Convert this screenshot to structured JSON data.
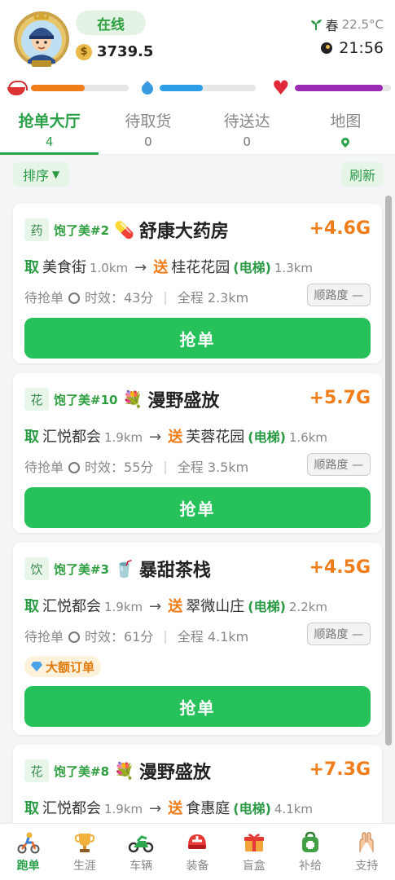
{
  "header": {
    "status": "在线",
    "coins": "3739.5",
    "season": "春",
    "temperature": "22.5°C",
    "time": "21:56",
    "stats": {
      "food": 0.55,
      "water": 0.45,
      "heart": 0.92
    },
    "colors": {
      "food": "#f07d1a",
      "water": "#2d9ee8",
      "heart": "#9b2bb3"
    }
  },
  "tabs": [
    {
      "label": "抢单大厅",
      "count": "4"
    },
    {
      "label": "待取货",
      "count": "0"
    },
    {
      "label": "待送达",
      "count": "0"
    },
    {
      "label": "地图",
      "count": ""
    }
  ],
  "toolbar": {
    "sort_label": "排序",
    "sort_arrow": "▼",
    "refresh_label": "刷新"
  },
  "orders": [
    {
      "category": "药",
      "shop_tag": "饱了美#2",
      "shop_icon": "💊",
      "shop_name": "舒康大药房",
      "reward": "+4.6G",
      "pick_label": "取",
      "pick_place": "美食街",
      "pick_dist": "1.0km",
      "drop_label": "送",
      "drop_place": "桂花花园",
      "elevator": "(电梯)",
      "drop_dist": "1.3km",
      "status": "待抢单",
      "time_limit": "时效：43分",
      "total": "全程 2.3km",
      "route_fit": "顺路度 —",
      "badge": "",
      "action": "抢单"
    },
    {
      "category": "花",
      "shop_tag": "饱了美#10",
      "shop_icon": "💐",
      "shop_name": "漫野盛放",
      "reward": "+5.7G",
      "pick_label": "取",
      "pick_place": "汇悦都会",
      "pick_dist": "1.9km",
      "drop_label": "送",
      "drop_place": "芙蓉花园",
      "elevator": "(电梯)",
      "drop_dist": "1.6km",
      "status": "待抢单",
      "time_limit": "时效：55分",
      "total": "全程 3.5km",
      "route_fit": "顺路度 —",
      "badge": "",
      "action": "抢单"
    },
    {
      "category": "饮",
      "shop_tag": "饱了美#3",
      "shop_icon": "🥤",
      "shop_name": "暴甜茶栈",
      "reward": "+4.5G",
      "pick_label": "取",
      "pick_place": "汇悦都会",
      "pick_dist": "1.9km",
      "drop_label": "送",
      "drop_place": "翠微山庄",
      "elevator": "(电梯)",
      "drop_dist": "2.2km",
      "status": "待抢单",
      "time_limit": "时效：61分",
      "total": "全程 4.1km",
      "route_fit": "顺路度 —",
      "badge": "大额订单",
      "action": "抢单"
    },
    {
      "category": "花",
      "shop_tag": "饱了美#8",
      "shop_icon": "💐",
      "shop_name": "漫野盛放",
      "reward": "+7.3G",
      "pick_label": "取",
      "pick_place": "汇悦都会",
      "pick_dist": "1.9km",
      "drop_label": "送",
      "drop_place": "食惠庭",
      "elevator": "(电梯)",
      "drop_dist": "4.1km",
      "status": "",
      "time_limit": "",
      "total": "",
      "route_fit": "",
      "badge": "",
      "action": ""
    }
  ],
  "bottom_nav": [
    {
      "label": "跑单",
      "icon": "rider-icon"
    },
    {
      "label": "生涯",
      "icon": "trophy-icon"
    },
    {
      "label": "车辆",
      "icon": "motorbike-icon"
    },
    {
      "label": "装备",
      "icon": "helmet-icon"
    },
    {
      "label": "盲盒",
      "icon": "gift-box-icon"
    },
    {
      "label": "补给",
      "icon": "supply-bag-icon"
    },
    {
      "label": "支持",
      "icon": "hands-icon"
    }
  ]
}
